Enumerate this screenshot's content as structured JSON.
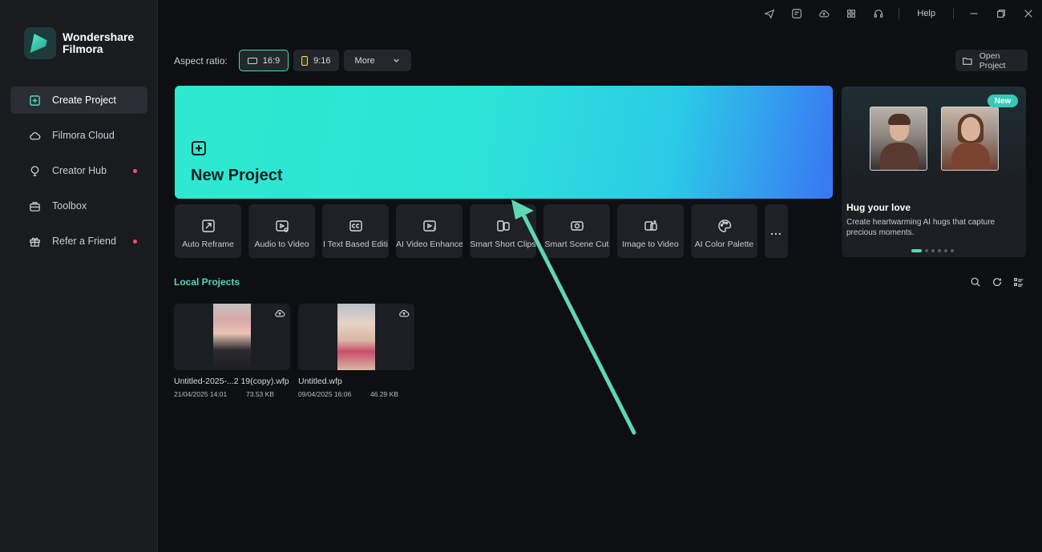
{
  "app": {
    "logo_line1": "Wondershare",
    "logo_line2": "Filmora"
  },
  "sidebar": {
    "items": [
      {
        "label": "Create Project",
        "icon": "plus-square-icon",
        "active": true,
        "dot": false
      },
      {
        "label": "Filmora Cloud",
        "icon": "cloud-icon",
        "active": false,
        "dot": false
      },
      {
        "label": "Creator Hub",
        "icon": "bulb-icon",
        "active": false,
        "dot": true
      },
      {
        "label": "Toolbox",
        "icon": "toolbox-icon",
        "active": false,
        "dot": false
      },
      {
        "label": "Refer a Friend",
        "icon": "gift-icon",
        "active": false,
        "dot": true
      }
    ]
  },
  "titlebar": {
    "help_label": "Help"
  },
  "aspect": {
    "label": "Aspect ratio:",
    "options": [
      "16:9",
      "9:16"
    ],
    "selected": "16:9",
    "more_label": "More"
  },
  "open_project_label": "Open Project",
  "new_project": {
    "title": "New Project"
  },
  "tools": [
    {
      "label": "Auto Reframe",
      "icon": "auto-reframe-icon"
    },
    {
      "label": "Audio to Video",
      "icon": "audio-to-video-icon"
    },
    {
      "label": "I Text Based Editi",
      "icon": "caption-icon"
    },
    {
      "label": "AI Video Enhance",
      "icon": "video-enhance-icon"
    },
    {
      "label": "Smart Short Clips",
      "icon": "short-clips-icon"
    },
    {
      "label": "Smart Scene Cut",
      "icon": "scene-cut-icon"
    },
    {
      "label": "Image to Video",
      "icon": "image-to-video-icon"
    },
    {
      "label": "AI Color Palette",
      "icon": "color-palette-icon"
    }
  ],
  "tools_more_label": "...",
  "promo": {
    "badge": "New",
    "title": "Hug your love",
    "description": "Create heartwarming AI hugs that capture precious moments."
  },
  "local_projects": {
    "title": "Local Projects",
    "items": [
      {
        "name": "Untitled-2025-...2 19(copy).wfp",
        "date": "21/04/2025 14:01",
        "size": "73.53 KB"
      },
      {
        "name": "Untitled.wfp",
        "date": "09/04/2025 16:06",
        "size": "46.29 KB"
      }
    ]
  },
  "colors": {
    "accent": "#56d6bd",
    "new_project_gradient_start": "#2ee8cf",
    "new_project_gradient_end": "#3a76f3",
    "annotation_arrow": "#5fd6b4"
  }
}
